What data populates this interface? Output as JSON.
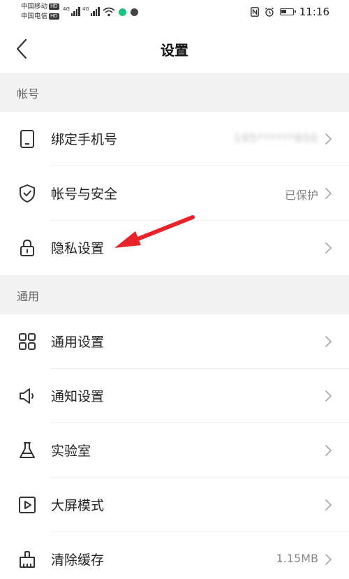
{
  "status_bar": {
    "carrier1": "中国移动",
    "carrier2": "中国电信",
    "hd": "HD",
    "net1": "4G",
    "net2": "4G",
    "time": "11:16"
  },
  "header": {
    "title": "设置",
    "back_icon": "chevron-left-icon"
  },
  "sections": [
    {
      "title": "帐号",
      "items": [
        {
          "label": "绑定手机号",
          "value": "185******850",
          "icon": "phone-icon"
        },
        {
          "label": "帐号与安全",
          "value": "已保护",
          "icon": "shield-icon"
        },
        {
          "label": "隐私设置",
          "value": "",
          "icon": "lock-icon"
        }
      ]
    },
    {
      "title": "通用",
      "items": [
        {
          "label": "通用设置",
          "value": "",
          "icon": "grid-icon"
        },
        {
          "label": "通知设置",
          "value": "",
          "icon": "speaker-icon"
        },
        {
          "label": "实验室",
          "value": "",
          "icon": "flask-icon"
        },
        {
          "label": "大屏模式",
          "value": "",
          "icon": "play-screen-icon"
        },
        {
          "label": "清除缓存",
          "value": "1.15MB",
          "icon": "broom-icon"
        }
      ]
    }
  ],
  "annotation_color": "#e8232a"
}
